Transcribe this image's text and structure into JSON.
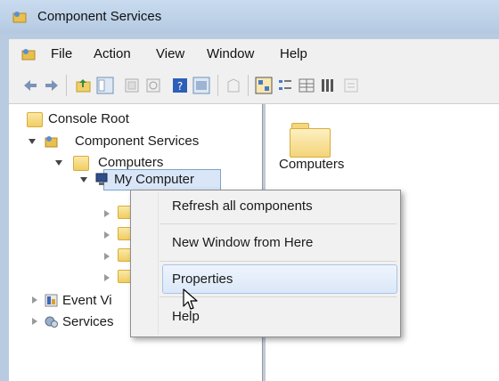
{
  "window": {
    "title": "Component Services"
  },
  "menu": {
    "items": [
      "File",
      "Action",
      "View",
      "Window",
      "Help"
    ]
  },
  "toolbar": {
    "icons": [
      "back-icon",
      "forward-icon",
      "up-folder-icon",
      "show-hide-tree-icon",
      "export-icon",
      "refresh-icon",
      "help-icon",
      "console-icon",
      "new-window-icon",
      "large-icons-view-icon",
      "small-icons-view-icon",
      "list-view-icon",
      "detail-view-icon",
      "properties-icon"
    ]
  },
  "tree": {
    "console_root": "Console Root",
    "component_services": "Component Services",
    "computers": "Computers",
    "my_computer": "My Computer",
    "event_viewer": "Event Vi",
    "services": "Services"
  },
  "content": {
    "folder_label": "Computers"
  },
  "context_menu": {
    "refresh": "Refresh all components",
    "new_window": "New Window from Here",
    "properties": "Properties",
    "help": "Help"
  }
}
